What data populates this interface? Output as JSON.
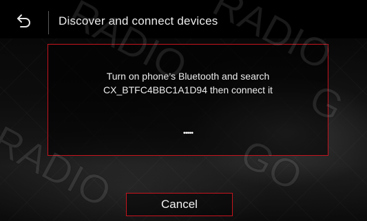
{
  "header": {
    "back_icon": "back-arrow-icon",
    "title": "Discover and connect devices"
  },
  "dialog": {
    "message_line1": "Turn on phone’s Bluetooth and search",
    "message_line2": "CX_BTFC4BBC1A1D94 then connect it",
    "progress_indicator": "•••••"
  },
  "actions": {
    "cancel_label": "Cancel"
  },
  "watermark": {
    "text_1": "RADIO",
    "text_2": "RADIO",
    "text_3": "GO",
    "text_4": "RADIO",
    "text_5": "G"
  },
  "colors": {
    "accent_border": "#c8141e",
    "background": "#000000",
    "text": "#eeeeee"
  }
}
